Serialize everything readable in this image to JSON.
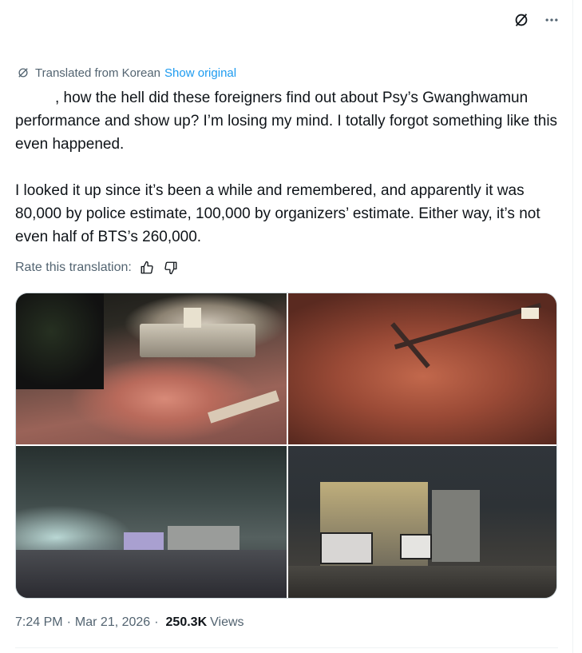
{
  "translation": {
    "label": "Translated from Korean",
    "show_original": "Show original"
  },
  "tweet": {
    "paragraph1": ", how the hell did these foreigners find out about Psy’s Gwanghwamun performance and show up? I’m losing my mind. I totally forgot something like this even happened.",
    "paragraph2": "I looked it up since it’s been a while and remembered, and apparently it was 80,000 by police estimate, 100,000 by organizers’ estimate. Either way, it’s not even half of BTS’s 260,000."
  },
  "rating": {
    "label": "Rate this translation:"
  },
  "meta": {
    "time": "7:24 PM",
    "separator": "·",
    "date": "Mar 21, 2026",
    "views_count": "250.3K",
    "views_label": "Views"
  },
  "icons": {
    "translate": "translate-icon",
    "more": "more-icon",
    "thumbs_up": "thumbs-up-icon",
    "thumbs_down": "thumbs-down-icon"
  },
  "colors": {
    "link": "#1d9bf0",
    "secondary_text": "#536471",
    "primary_text": "#0f1419"
  }
}
